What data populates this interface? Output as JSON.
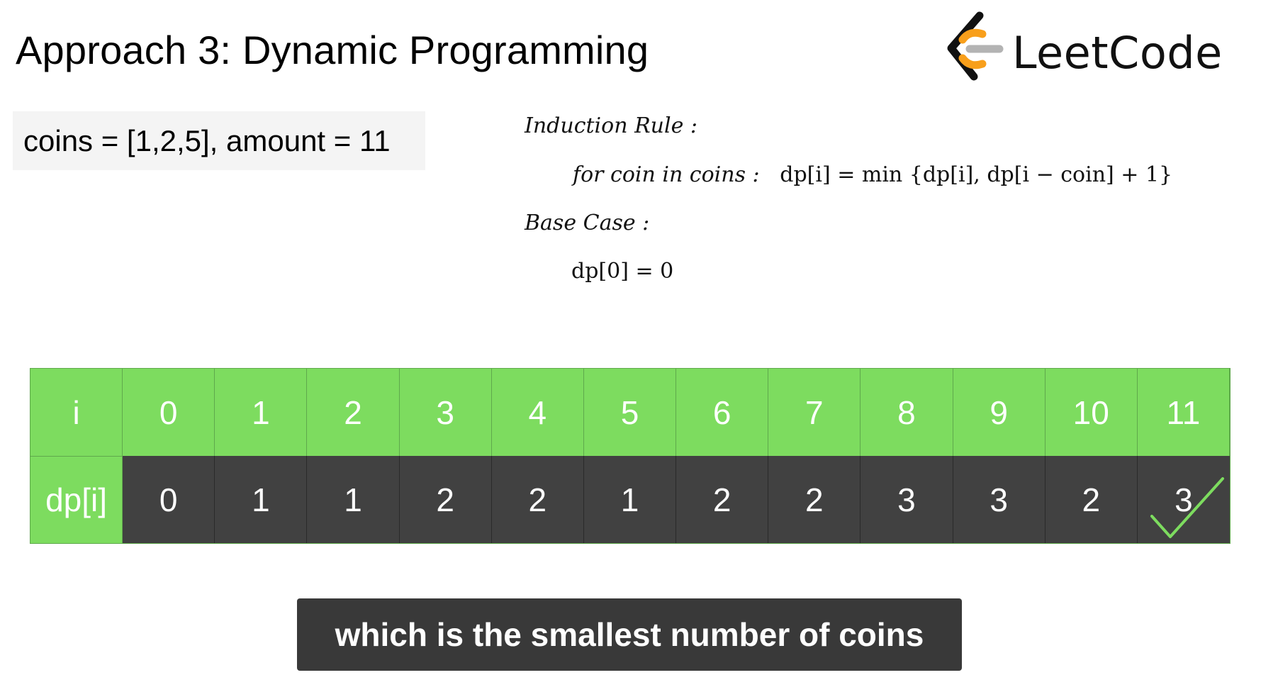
{
  "header": {
    "title": "Approach 3: Dynamic Programming",
    "logo_text": "LeetCode",
    "logo_icon": "leetcode-logo-icon"
  },
  "example": {
    "text": "coins = [1,2,5], amount = 11"
  },
  "formulas": {
    "induction_label": "Induction Rule :",
    "induction_prefix": "for coin in coins :",
    "induction_formula": "dp[i] = min {dp[i], dp[i − coin] + 1}",
    "base_label": "Base Case :",
    "base_formula": "dp[0] = 0"
  },
  "table": {
    "row_labels": [
      "i",
      "dp[i]"
    ],
    "i": [
      "0",
      "1",
      "2",
      "3",
      "4",
      "5",
      "6",
      "7",
      "8",
      "9",
      "10",
      "11"
    ],
    "dp": [
      "0",
      "1",
      "1",
      "2",
      "2",
      "1",
      "2",
      "2",
      "3",
      "3",
      "2",
      "3"
    ],
    "checked_index": 11
  },
  "caption": {
    "text": "which is the smallest number of coins"
  },
  "colors": {
    "header_green": "#7ddc5f",
    "cell_dark": "#414141",
    "check_green": "#7ddc5f",
    "caption_bg": "#393939",
    "logo_orange": "#f89f1b",
    "logo_gray": "#b3b3b3"
  }
}
